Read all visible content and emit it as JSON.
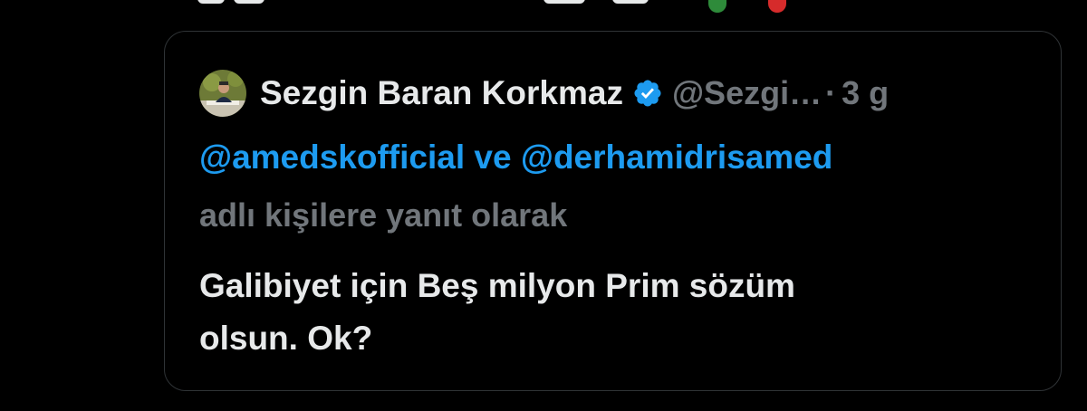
{
  "colors": {
    "background": "#000000",
    "text_primary": "#e7e9ea",
    "text_secondary": "#71767b",
    "link": "#1d9bf0",
    "card_border": "#2f3336",
    "verified_badge": "#1d9bf0"
  },
  "quoted_tweet": {
    "author_name": "Sezgin Baran Korkmaz",
    "verified": true,
    "verified_icon": "verified-badge-icon",
    "handle": "@Sezgi…",
    "separator": "·",
    "timestamp": "3 g",
    "reply_to": {
      "user_1": "@amedskofficial",
      "conjunction": " ve ",
      "user_2": "@derhamidrisamed",
      "suffix": "adlı kişilere yanıt olarak"
    },
    "body_line_1": "Galibiyet için Beş milyon Prim sözüm",
    "body_line_2": "olsun. Ok?"
  }
}
